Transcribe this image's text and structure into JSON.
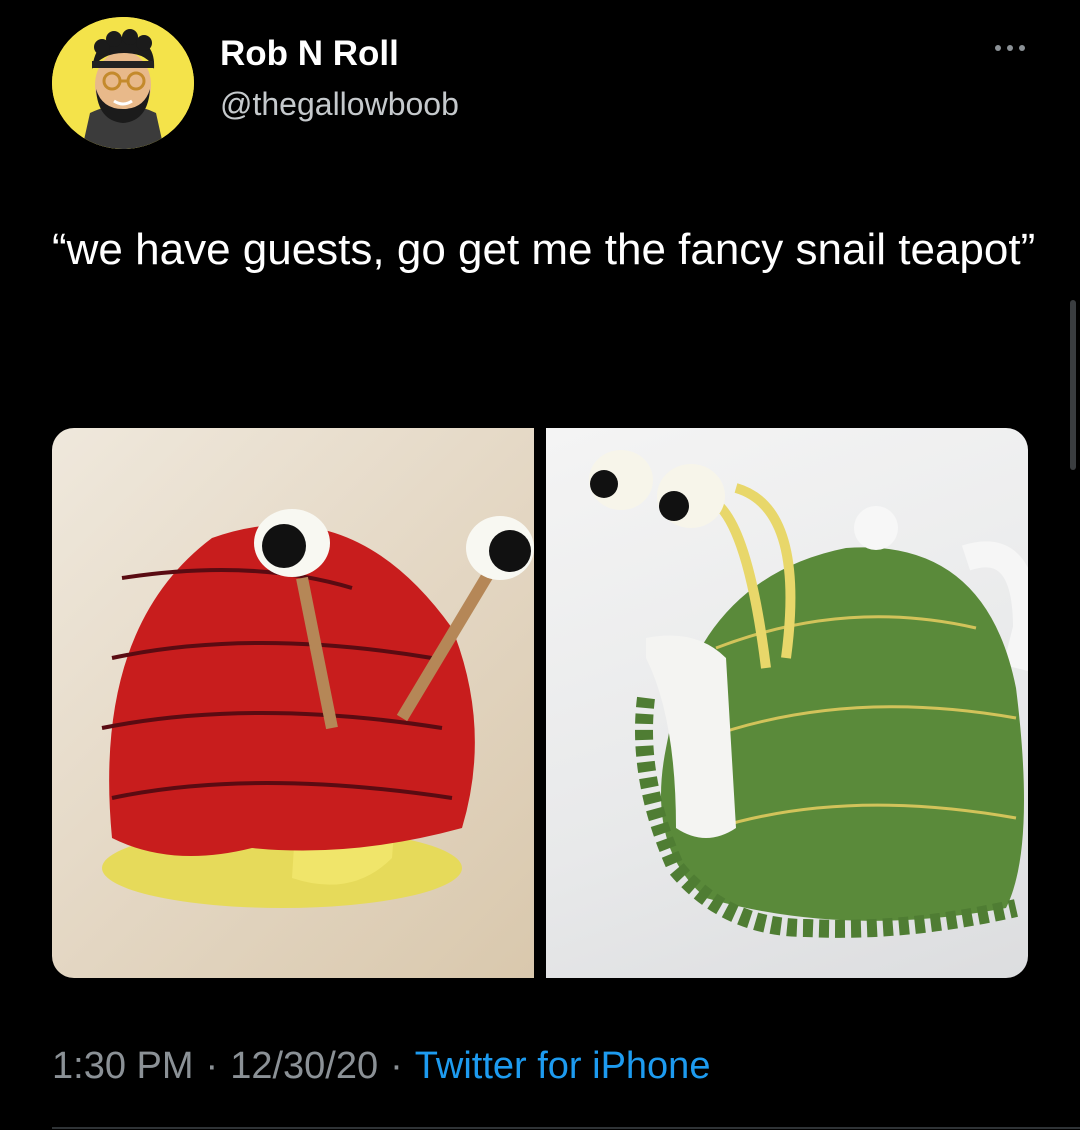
{
  "author": {
    "name": "Rob N Roll",
    "handle": "@thegallowboob",
    "avatar_bg": "#f4e34a"
  },
  "more_icon": "more-dots-icon",
  "tweet": {
    "text": "“we have guests, go get me the fancy snail teapot”"
  },
  "meta": {
    "time": "1:30 PM",
    "separator": "·",
    "date": "12/30/20",
    "source": "Twitter for iPhone"
  },
  "colors": {
    "background": "#000000",
    "primary_text": "#ffffff",
    "secondary_text": "#8b9196",
    "link": "#1d9bf0"
  }
}
